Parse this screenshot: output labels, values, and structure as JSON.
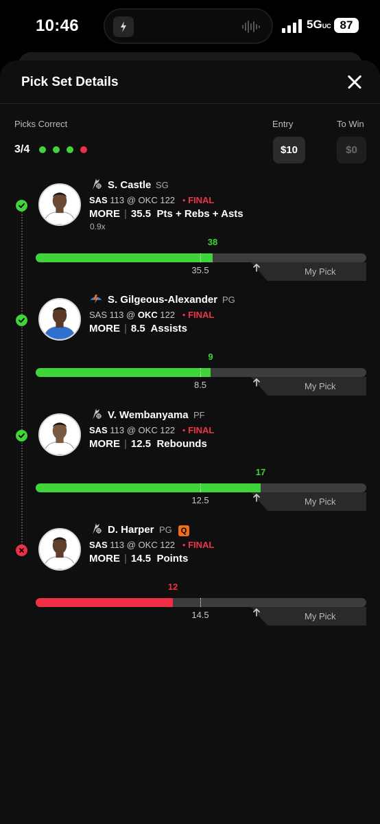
{
  "status_bar": {
    "time": "10:46",
    "network": "5G",
    "network_suffix": "UC",
    "battery": "87"
  },
  "sheet": {
    "title": "Pick Set Details",
    "picks_correct_label": "Picks Correct",
    "picks_correct_value": "3/4",
    "entry_label": "Entry",
    "entry_value": "$10",
    "to_win_label": "To Win",
    "to_win_value": "$0",
    "results": [
      "correct",
      "correct",
      "correct",
      "incorrect"
    ],
    "colors": {
      "correct": "#3fd43a",
      "incorrect": "#ef2f45",
      "accent_orange": "#f26b1d"
    }
  },
  "picks": [
    {
      "name": "S. Castle",
      "position": "SG",
      "team_logo": "spurs-logo",
      "away_team": "SAS",
      "away_score": "113",
      "at": "@",
      "home_team": "OKC",
      "home_score": "122",
      "bold_team": "away",
      "status": "FINAL",
      "direction": "MORE",
      "line": "35.5",
      "stat": "Pts + Rebs + Asts",
      "multiplier": "0.9x",
      "result": "38",
      "result_fraction": 0.535,
      "line_fraction": 0.498,
      "outcome": "correct",
      "my_pick_label": "My Pick"
    },
    {
      "name": "S. Gilgeous-Alexander",
      "position": "PG",
      "team_logo": "thunder-logo",
      "away_team": "SAS",
      "away_score": "113",
      "at": "@",
      "home_team": "OKC",
      "home_score": "122",
      "bold_team": "home",
      "status": "FINAL",
      "direction": "MORE",
      "line": "8.5",
      "stat": "Assists",
      "multiplier": "",
      "result": "9",
      "result_fraction": 0.53,
      "line_fraction": 0.498,
      "outcome": "correct",
      "my_pick_label": "My Pick"
    },
    {
      "name": "V. Wembanyama",
      "position": "PF",
      "team_logo": "spurs-logo",
      "away_team": "SAS",
      "away_score": "113",
      "at": "@",
      "home_team": "OKC",
      "home_score": "122",
      "bold_team": "away",
      "status": "FINAL",
      "direction": "MORE",
      "line": "12.5",
      "stat": "Rebounds",
      "multiplier": "",
      "result": "17",
      "result_fraction": 0.68,
      "line_fraction": 0.498,
      "outcome": "correct",
      "my_pick_label": "My Pick"
    },
    {
      "name": "D. Harper",
      "position": "PG",
      "badge": "Q",
      "team_logo": "spurs-logo",
      "away_team": "SAS",
      "away_score": "113",
      "at": "@",
      "home_team": "OKC",
      "home_score": "122",
      "bold_team": "away",
      "status": "FINAL",
      "direction": "MORE",
      "line": "14.5",
      "stat": "Points",
      "multiplier": "",
      "result": "12",
      "result_fraction": 0.415,
      "line_fraction": 0.498,
      "outcome": "incorrect",
      "my_pick_label": "My Pick"
    }
  ]
}
